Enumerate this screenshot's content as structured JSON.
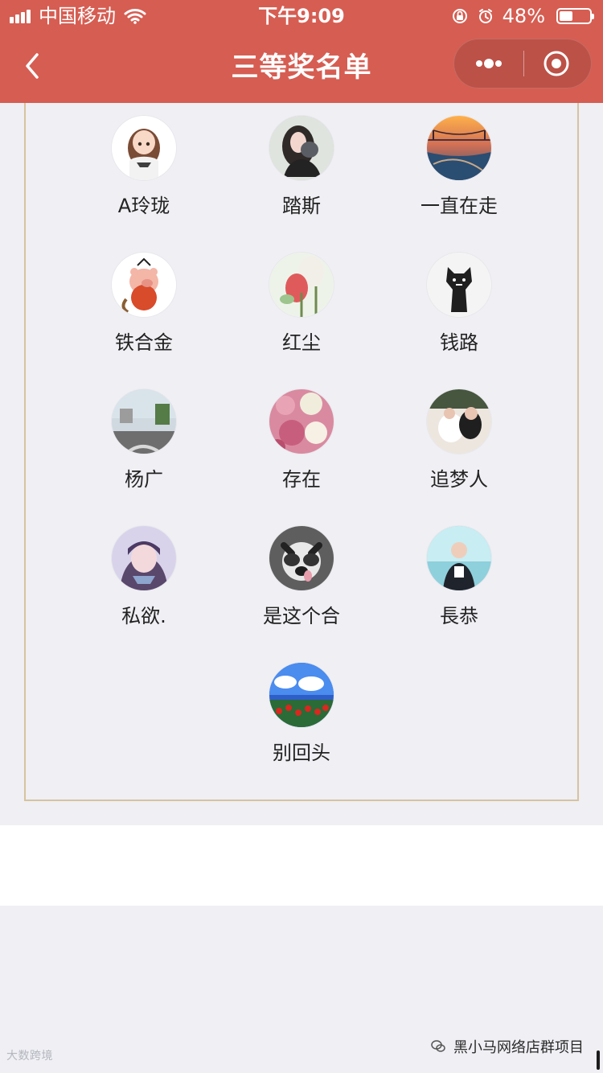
{
  "status_bar": {
    "carrier": "中国移动",
    "time": "下午9:09",
    "battery": "48%"
  },
  "nav": {
    "title": "三等奖名单",
    "back_icon": "chevron-left-icon",
    "more_icon": "more-icon",
    "close_icon": "target-icon"
  },
  "winners": [
    {
      "name": "A玲珑"
    },
    {
      "name": "踏斯"
    },
    {
      "name": "一直在走"
    },
    {
      "name": "铁合金"
    },
    {
      "name": "红尘"
    },
    {
      "name": "钱路"
    },
    {
      "name": "杨广"
    },
    {
      "name": "存在"
    },
    {
      "name": "追梦人"
    },
    {
      "name": "私欲."
    },
    {
      "name": "是这个合"
    },
    {
      "name": "長恭"
    },
    {
      "name": "别回头"
    }
  ],
  "watermark": {
    "left": "大数跨境",
    "right": "黑小马网络店群项目"
  },
  "colors": {
    "header_bg": "#d65d52",
    "page_bg": "#efeff4",
    "border": "#d7c39d"
  }
}
